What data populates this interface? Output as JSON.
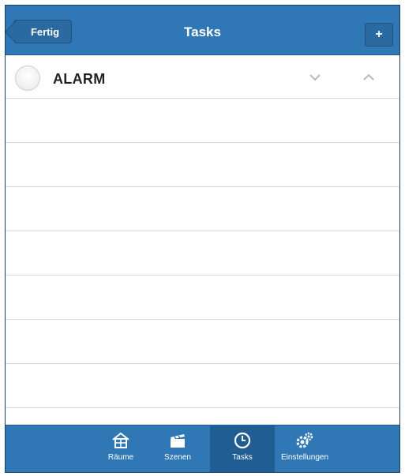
{
  "header": {
    "back_label": "Fertig",
    "title": "Tasks",
    "add_label": "+"
  },
  "tasks": [
    {
      "label": "ALARM"
    }
  ],
  "tabbar": {
    "items": [
      {
        "label": "Räume",
        "icon": "house-icon",
        "active": false
      },
      {
        "label": "Szenen",
        "icon": "clapperboard-icon",
        "active": false
      },
      {
        "label": "Tasks",
        "icon": "clock-icon",
        "active": true
      },
      {
        "label": "Einstellungen",
        "icon": "gears-icon",
        "active": false
      }
    ]
  },
  "colors": {
    "brand_blue": "#2f78b5",
    "active_tab": "#1f5d92",
    "divider": "#dadada"
  }
}
